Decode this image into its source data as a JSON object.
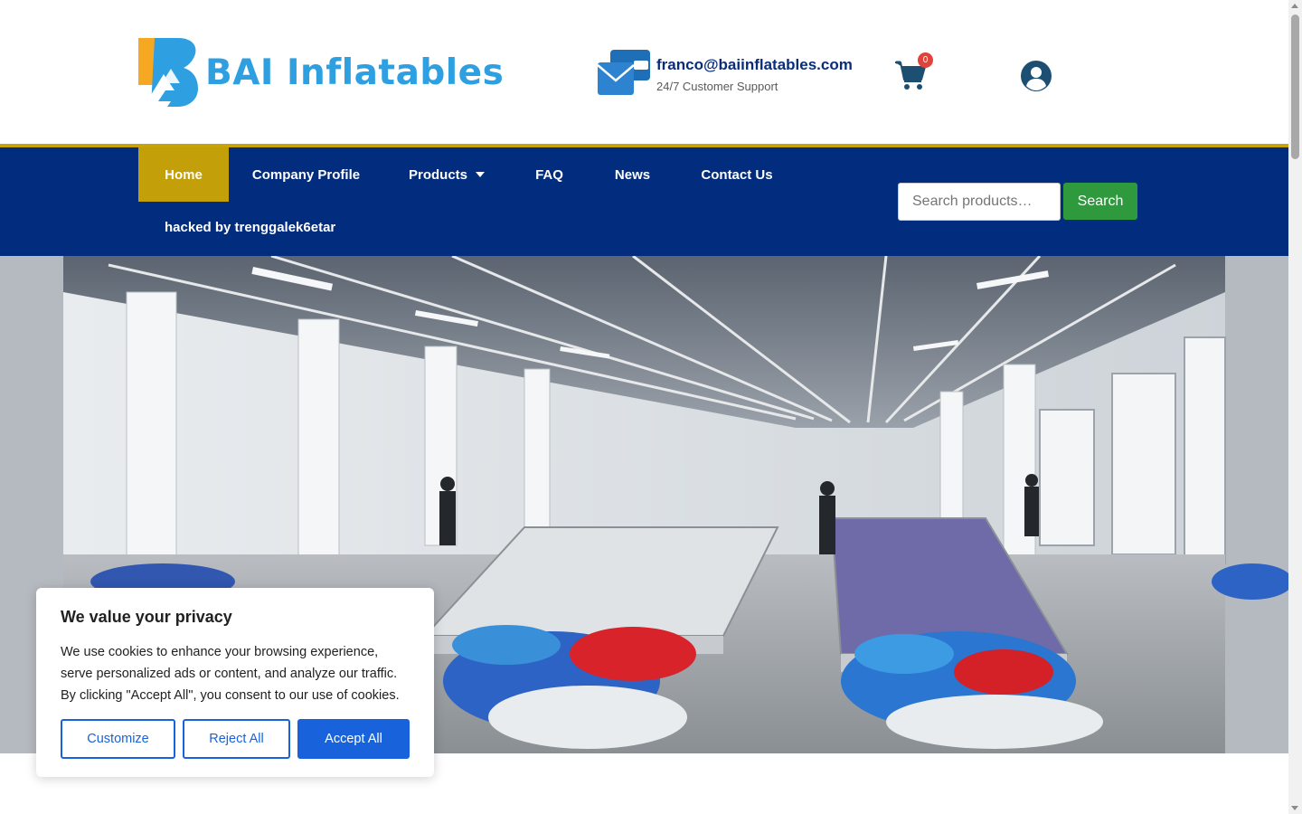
{
  "header": {
    "brand_name": "BAI Inflatables",
    "contact_email": "franco@baiinflatables.com",
    "contact_subtitle": "24/7 Customer Support",
    "cart_count": "0",
    "icons": [
      "brand-logo-icon",
      "mail-icon",
      "cart-icon",
      "user-circle-icon"
    ]
  },
  "nav": {
    "items": [
      {
        "label": "Home",
        "active": true
      },
      {
        "label": "Company Profile"
      },
      {
        "label": "Products",
        "has_dropdown": true
      },
      {
        "label": "FAQ"
      },
      {
        "label": "News"
      },
      {
        "label": "Contact Us"
      }
    ],
    "second_row_item": "hacked by trenggalek6etar",
    "search_placeholder": "Search products…",
    "search_button": "Search"
  },
  "cookie_banner": {
    "title": "We value your privacy",
    "text": "We use cookies to enhance your browsing experience, serve personalized ads or content, and analyze our traffic. By clicking \"Accept All\", you consent to our use of cookies.",
    "customize_label": "Customize",
    "reject_label": "Reject All",
    "accept_label": "Accept All"
  },
  "colors": {
    "brand_blue": "#2e9fe0",
    "brand_orange": "#f7a823",
    "nav_background": "#022c7e",
    "nav_active": "#c39f09",
    "search_button": "#2f9a3d",
    "cookie_accent": "#1863dc",
    "cart_badge": "#e0433a"
  }
}
